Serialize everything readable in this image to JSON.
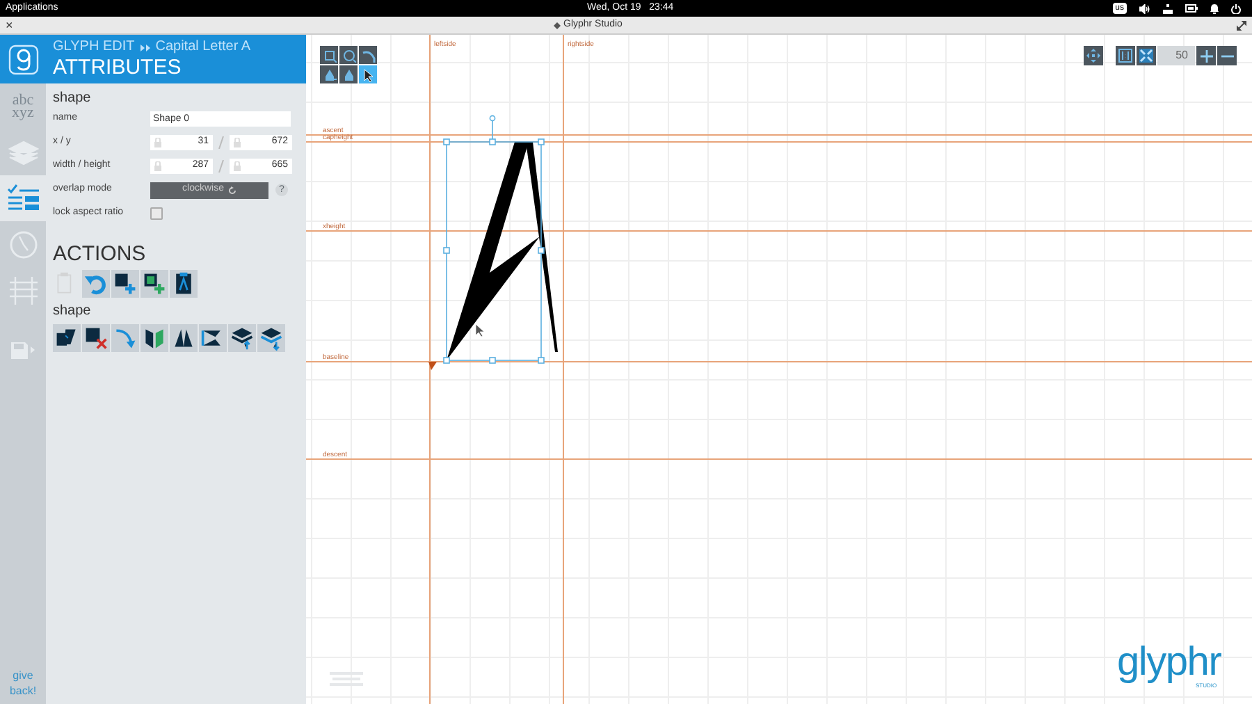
{
  "top_bar": {
    "menu": "Applications",
    "clock": "Wed, Oct 19   23:44",
    "keyboard_layout": "us"
  },
  "window": {
    "title": "Glyphr Studio",
    "close": "×"
  },
  "rail": {
    "items": [
      {
        "kind": "logo"
      },
      {
        "kind": "chooser",
        "line_1": "abc",
        "line_2": "xyz",
        "selected": false
      },
      {
        "kind": "layers",
        "selected": false
      },
      {
        "kind": "attributes",
        "selected": true
      },
      {
        "kind": "history",
        "selected": false
      },
      {
        "kind": "guides",
        "selected": false
      },
      {
        "kind": "save",
        "selected": false
      }
    ],
    "footer_line_1": "give",
    "footer_line_2": "back!"
  },
  "panel": {
    "breadcrumb": "GLYPH EDIT",
    "glyph": "Capital Letter A",
    "title": "ATTRIBUTES",
    "section": "shape",
    "rows": [
      {
        "kind": "text",
        "label": "name",
        "value": "Shape 0"
      },
      {
        "kind": "pair",
        "label": "x / y",
        "value_1": "31",
        "value_2": "672"
      },
      {
        "kind": "pair",
        "label": "width / height",
        "value_1": "287",
        "value_2": "665"
      },
      {
        "kind": "button",
        "label": "overlap mode",
        "value": "clockwise",
        "help": "?"
      },
      {
        "kind": "checkbox",
        "label": "lock aspect ratio",
        "checked": false
      }
    ],
    "actions_title": "ACTIONS",
    "actions": [
      {
        "kind": "paste",
        "disabled": true
      },
      {
        "kind": "undo",
        "disabled": false
      },
      {
        "kind": "add-shape",
        "disabled": false
      },
      {
        "kind": "add-path",
        "disabled": false
      },
      {
        "kind": "clear",
        "disabled": false
      }
    ],
    "shape_title": "shape",
    "shape_actions": [
      {
        "kind": "copy"
      },
      {
        "kind": "delete"
      },
      {
        "kind": "reverse"
      },
      {
        "kind": "flip-h"
      },
      {
        "kind": "flip-v"
      },
      {
        "kind": "skew"
      },
      {
        "kind": "layer-up"
      },
      {
        "kind": "layer-down"
      }
    ]
  },
  "canvas": {
    "tools": [
      {
        "kind": "rect",
        "selected": false
      },
      {
        "kind": "oval",
        "selected": false
      },
      {
        "kind": "pen",
        "selected": false
      },
      {
        "kind": "add-point",
        "selected": false
      },
      {
        "kind": "point",
        "selected": false
      },
      {
        "kind": "pointer",
        "selected": true
      }
    ],
    "zoom": "50",
    "guides": [
      {
        "kind": "v",
        "label": "leftside"
      },
      {
        "kind": "v",
        "label": "rightside"
      },
      {
        "kind": "h",
        "label": "ascent"
      },
      {
        "kind": "h",
        "label": "capheight"
      },
      {
        "kind": "h",
        "label": "xheight"
      },
      {
        "kind": "h",
        "label": "baseline"
      },
      {
        "kind": "h",
        "label": "descent"
      }
    ],
    "brand": "glyphr",
    "brand_sub": "STUDIO"
  }
}
